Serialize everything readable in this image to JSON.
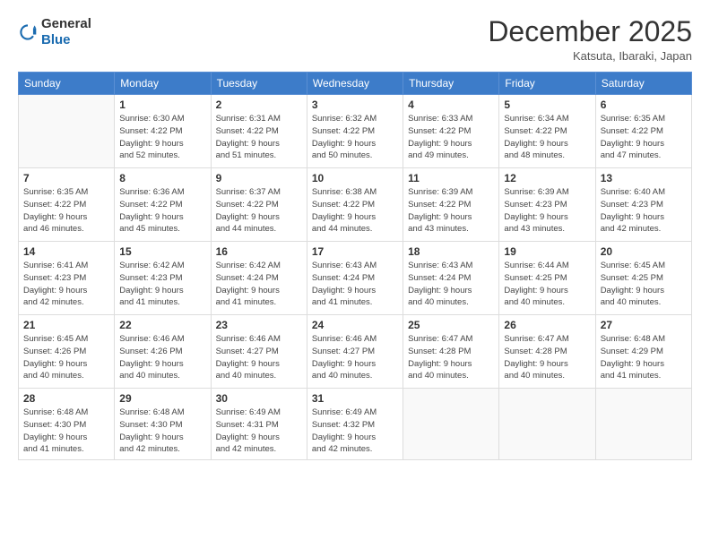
{
  "logo": {
    "general": "General",
    "blue": "Blue"
  },
  "header": {
    "month": "December 2025",
    "location": "Katsuta, Ibaraki, Japan"
  },
  "weekdays": [
    "Sunday",
    "Monday",
    "Tuesday",
    "Wednesday",
    "Thursday",
    "Friday",
    "Saturday"
  ],
  "weeks": [
    [
      {
        "day": "",
        "info": ""
      },
      {
        "day": "1",
        "info": "Sunrise: 6:30 AM\nSunset: 4:22 PM\nDaylight: 9 hours\nand 52 minutes."
      },
      {
        "day": "2",
        "info": "Sunrise: 6:31 AM\nSunset: 4:22 PM\nDaylight: 9 hours\nand 51 minutes."
      },
      {
        "day": "3",
        "info": "Sunrise: 6:32 AM\nSunset: 4:22 PM\nDaylight: 9 hours\nand 50 minutes."
      },
      {
        "day": "4",
        "info": "Sunrise: 6:33 AM\nSunset: 4:22 PM\nDaylight: 9 hours\nand 49 minutes."
      },
      {
        "day": "5",
        "info": "Sunrise: 6:34 AM\nSunset: 4:22 PM\nDaylight: 9 hours\nand 48 minutes."
      },
      {
        "day": "6",
        "info": "Sunrise: 6:35 AM\nSunset: 4:22 PM\nDaylight: 9 hours\nand 47 minutes."
      }
    ],
    [
      {
        "day": "7",
        "info": "Sunrise: 6:35 AM\nSunset: 4:22 PM\nDaylight: 9 hours\nand 46 minutes."
      },
      {
        "day": "8",
        "info": "Sunrise: 6:36 AM\nSunset: 4:22 PM\nDaylight: 9 hours\nand 45 minutes."
      },
      {
        "day": "9",
        "info": "Sunrise: 6:37 AM\nSunset: 4:22 PM\nDaylight: 9 hours\nand 44 minutes."
      },
      {
        "day": "10",
        "info": "Sunrise: 6:38 AM\nSunset: 4:22 PM\nDaylight: 9 hours\nand 44 minutes."
      },
      {
        "day": "11",
        "info": "Sunrise: 6:39 AM\nSunset: 4:22 PM\nDaylight: 9 hours\nand 43 minutes."
      },
      {
        "day": "12",
        "info": "Sunrise: 6:39 AM\nSunset: 4:23 PM\nDaylight: 9 hours\nand 43 minutes."
      },
      {
        "day": "13",
        "info": "Sunrise: 6:40 AM\nSunset: 4:23 PM\nDaylight: 9 hours\nand 42 minutes."
      }
    ],
    [
      {
        "day": "14",
        "info": "Sunrise: 6:41 AM\nSunset: 4:23 PM\nDaylight: 9 hours\nand 42 minutes."
      },
      {
        "day": "15",
        "info": "Sunrise: 6:42 AM\nSunset: 4:23 PM\nDaylight: 9 hours\nand 41 minutes."
      },
      {
        "day": "16",
        "info": "Sunrise: 6:42 AM\nSunset: 4:24 PM\nDaylight: 9 hours\nand 41 minutes."
      },
      {
        "day": "17",
        "info": "Sunrise: 6:43 AM\nSunset: 4:24 PM\nDaylight: 9 hours\nand 41 minutes."
      },
      {
        "day": "18",
        "info": "Sunrise: 6:43 AM\nSunset: 4:24 PM\nDaylight: 9 hours\nand 40 minutes."
      },
      {
        "day": "19",
        "info": "Sunrise: 6:44 AM\nSunset: 4:25 PM\nDaylight: 9 hours\nand 40 minutes."
      },
      {
        "day": "20",
        "info": "Sunrise: 6:45 AM\nSunset: 4:25 PM\nDaylight: 9 hours\nand 40 minutes."
      }
    ],
    [
      {
        "day": "21",
        "info": "Sunrise: 6:45 AM\nSunset: 4:26 PM\nDaylight: 9 hours\nand 40 minutes."
      },
      {
        "day": "22",
        "info": "Sunrise: 6:46 AM\nSunset: 4:26 PM\nDaylight: 9 hours\nand 40 minutes."
      },
      {
        "day": "23",
        "info": "Sunrise: 6:46 AM\nSunset: 4:27 PM\nDaylight: 9 hours\nand 40 minutes."
      },
      {
        "day": "24",
        "info": "Sunrise: 6:46 AM\nSunset: 4:27 PM\nDaylight: 9 hours\nand 40 minutes."
      },
      {
        "day": "25",
        "info": "Sunrise: 6:47 AM\nSunset: 4:28 PM\nDaylight: 9 hours\nand 40 minutes."
      },
      {
        "day": "26",
        "info": "Sunrise: 6:47 AM\nSunset: 4:28 PM\nDaylight: 9 hours\nand 40 minutes."
      },
      {
        "day": "27",
        "info": "Sunrise: 6:48 AM\nSunset: 4:29 PM\nDaylight: 9 hours\nand 41 minutes."
      }
    ],
    [
      {
        "day": "28",
        "info": "Sunrise: 6:48 AM\nSunset: 4:30 PM\nDaylight: 9 hours\nand 41 minutes."
      },
      {
        "day": "29",
        "info": "Sunrise: 6:48 AM\nSunset: 4:30 PM\nDaylight: 9 hours\nand 42 minutes."
      },
      {
        "day": "30",
        "info": "Sunrise: 6:49 AM\nSunset: 4:31 PM\nDaylight: 9 hours\nand 42 minutes."
      },
      {
        "day": "31",
        "info": "Sunrise: 6:49 AM\nSunset: 4:32 PM\nDaylight: 9 hours\nand 42 minutes."
      },
      {
        "day": "",
        "info": ""
      },
      {
        "day": "",
        "info": ""
      },
      {
        "day": "",
        "info": ""
      }
    ]
  ]
}
